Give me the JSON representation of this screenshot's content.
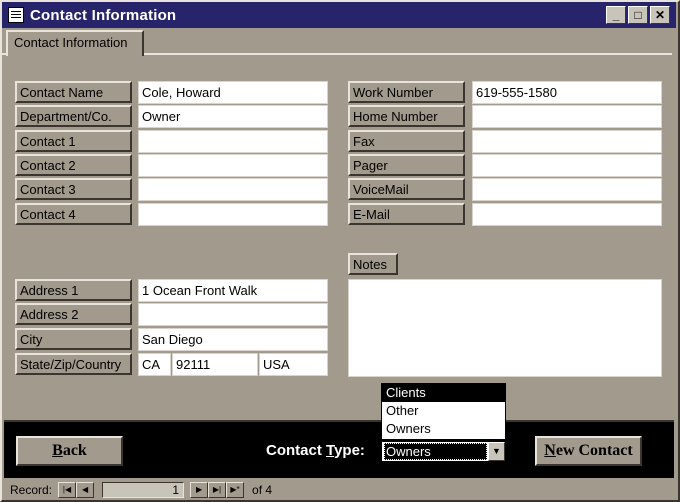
{
  "window": {
    "title": "Contact Information",
    "icon": "form-icon",
    "controls": [
      "minimize-icon",
      "maximize-icon",
      "close-icon"
    ],
    "minimize": "_",
    "maximize": "□",
    "close": "✕"
  },
  "tab": {
    "label": "Contact Information"
  },
  "left_fields": [
    {
      "label": "Contact Name",
      "value": "Cole, Howard"
    },
    {
      "label": "Department/Co.",
      "value": "Owner"
    },
    {
      "label": "Contact 1",
      "value": ""
    },
    {
      "label": "Contact 2",
      "value": ""
    },
    {
      "label": "Contact 3",
      "value": ""
    },
    {
      "label": "Contact 4",
      "value": ""
    }
  ],
  "right_fields": [
    {
      "label": "Work Number",
      "value": "619-555-1580"
    },
    {
      "label": "Home Number",
      "value": ""
    },
    {
      "label": "Fax",
      "value": ""
    },
    {
      "label": "Pager",
      "value": ""
    },
    {
      "label": "VoiceMail",
      "value": ""
    },
    {
      "label": "E-Mail",
      "value": ""
    }
  ],
  "address": [
    {
      "label": "Address 1",
      "value": "1 Ocean Front Walk"
    },
    {
      "label": "Address 2",
      "value": ""
    },
    {
      "label": "City",
      "value": "San Diego"
    }
  ],
  "state_zip_country": {
    "label": "State/Zip/Country",
    "state": "CA",
    "zip": "92111",
    "country": "USA"
  },
  "notes": {
    "label": "Notes",
    "value": ""
  },
  "bottom": {
    "back_label_u": "B",
    "back_label_rest": "ack",
    "contact_type_pre": "Contact ",
    "contact_type_u": "T",
    "contact_type_post": "ype:",
    "contact_type_value": "Owners",
    "contact_type_options": [
      "Clients",
      "Other",
      "Owners"
    ],
    "new_label_u": "N",
    "new_label_rest": "ew Contact"
  },
  "record_nav": {
    "label": "Record:",
    "current": "1",
    "of_text": "of 4",
    "first": "|◀",
    "prev": "◀",
    "next": "▶",
    "last": "▶|",
    "new": "▶*",
    "dropdown_arrow": "▼"
  },
  "colors": {
    "titlebar": "#27246b",
    "form_bg": "#a39a8e",
    "bottom_bar": "#000000"
  }
}
